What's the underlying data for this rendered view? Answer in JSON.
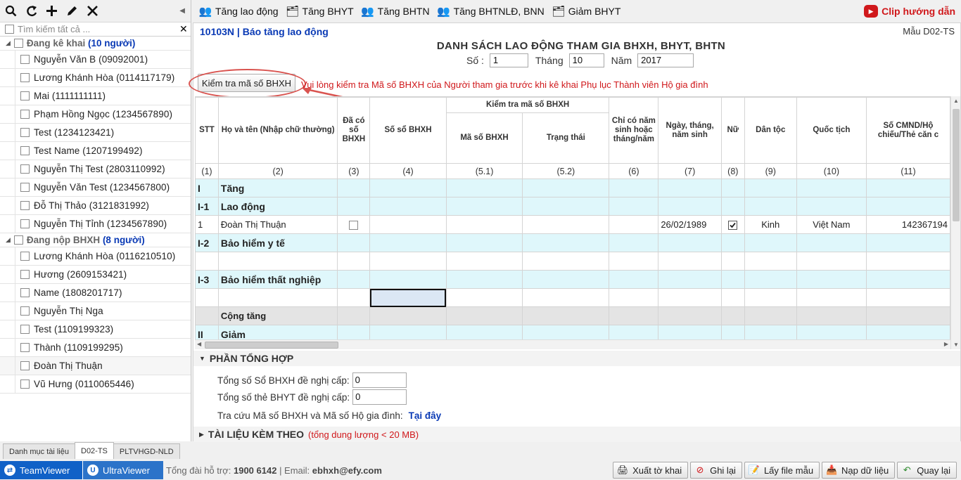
{
  "left_panel": {
    "toolbar_icons": [
      "search-icon",
      "refresh-icon",
      "add-icon",
      "edit-icon",
      "close-icon"
    ],
    "search_placeholder": "Tìm kiếm tất cả ...",
    "groups": [
      {
        "label": "Đang kê khai",
        "count": "(10 người)",
        "items": [
          "Nguyễn Văn B (09092001)",
          "Lương Khánh Hòa (0114117179)",
          "Mai (1111111111)",
          "Phạm Hồng Ngọc (1234567890)",
          "Test (1234123421)",
          "Test Name (1207199492)",
          "Nguyễn Thị Test (2803110992)",
          "Nguyễn Văn Test (1234567800)",
          "Đỗ Thị Thảo (3121831992)",
          "Nguyễn Thị Tỉnh (1234567890)"
        ]
      },
      {
        "label": "Đang nộp BHXH",
        "count": "(8 người)",
        "items": [
          "Lương Khánh Hòa (0116210510)",
          "Hương (2609153421)",
          "Name (1808201717)",
          "Nguyễn Thị Nga",
          "Test (1109199323)",
          "Thành (1109199295)",
          "Đoàn Thị Thuận",
          "Vũ Hưng (0110065446)"
        ]
      }
    ]
  },
  "bottom_tabs": [
    "Danh mục tài liệu",
    "D02-TS",
    "PLTVHGD-NLD"
  ],
  "toolbar": {
    "items": [
      "Tăng lao động",
      "Tăng BHYT",
      "Tăng BHTN",
      "Tăng BHTNLĐ, BNN",
      "Giảm BHYT"
    ],
    "clip_label": "Clip hướng dẫn"
  },
  "form": {
    "code": "10103N | Báo tăng lao động",
    "template": "Mẫu D02-TS",
    "title": "DANH SÁCH LAO ĐỘNG THAM GIA BHXH, BHYT, BHTN",
    "so_label": "Số :",
    "so_value": "1",
    "thang_label": "Tháng",
    "thang_value": "10",
    "nam_label": "Năm",
    "nam_value": "2017",
    "check_button": "Kiểm tra mã số BHXH",
    "warning": "Vui lòng kiểm tra Mã số BHXH của Người tham gia trước khi kê khai Phụ lục Thành viên Hộ gia đình"
  },
  "grid": {
    "group_header": "Kiểm tra mã số BHXH",
    "columns": [
      "STT",
      "Họ và tên (Nhập chữ thường)",
      "Đã có số BHXH",
      "Số sổ BHXH",
      "Mã số BHXH",
      "Trạng thái",
      "Chỉ có năm sinh hoặc tháng/năm",
      "Ngày, tháng, năm sinh",
      "Nữ",
      "Dân tộc",
      "Quốc tịch",
      "Số CMND/Hộ chiếu/Thẻ căn c"
    ],
    "col_numbers": [
      "(1)",
      "(2)",
      "(3)",
      "(4)",
      "(5.1)",
      "(5.2)",
      "(6)",
      "(7)",
      "(8)",
      "(9)",
      "(10)",
      "(11)"
    ],
    "sections": {
      "s1": {
        "stt": "I",
        "label": "Tăng"
      },
      "s2": {
        "stt": "I-1",
        "label": "Lao động"
      },
      "s3": {
        "stt": "I-2",
        "label": "Bảo hiểm y tế"
      },
      "s4": {
        "stt": "I-3",
        "label": "Bảo hiểm thất nghiệp"
      },
      "total": {
        "label": "Cộng tăng"
      },
      "s5": {
        "stt": "II",
        "label": "Giảm"
      }
    },
    "row1": {
      "stt": "1",
      "name": "Đoàn Thị Thuận",
      "dob": "26/02/1989",
      "ethnicity": "Kinh",
      "nationality": "Việt Nam",
      "id_number": "142367194"
    }
  },
  "summary": {
    "title": "PHẦN TỔNG HỢP",
    "total_so_label": "Tổng số Sổ BHXH đề nghị cấp:",
    "total_so_value": "0",
    "total_the_label": "Tổng số thẻ BHYT đề nghị cấp:",
    "total_the_value": "0",
    "lookup_label": "Tra cứu Mã số BHXH và Mã số Hộ gia đình:",
    "lookup_link": "Tại đây"
  },
  "attachments": {
    "title": "TÀI LIỆU KÈM THEO",
    "note": "(tổng dung lượng < 20 MB)"
  },
  "status_bar": {
    "teamviewer": "TeamViewer",
    "ultraviewer": "UltraViewer",
    "hotline_label": "Tổng đài hỗ trợ:",
    "hotline": "1900 6142",
    "email_label": "| Email:",
    "email": "ebhxh@efy.com",
    "buttons": [
      "Xuất tờ khai",
      "Ghi lại",
      "Lấy file mẫu",
      "Nạp dữ liệu",
      "Quay lại"
    ]
  }
}
